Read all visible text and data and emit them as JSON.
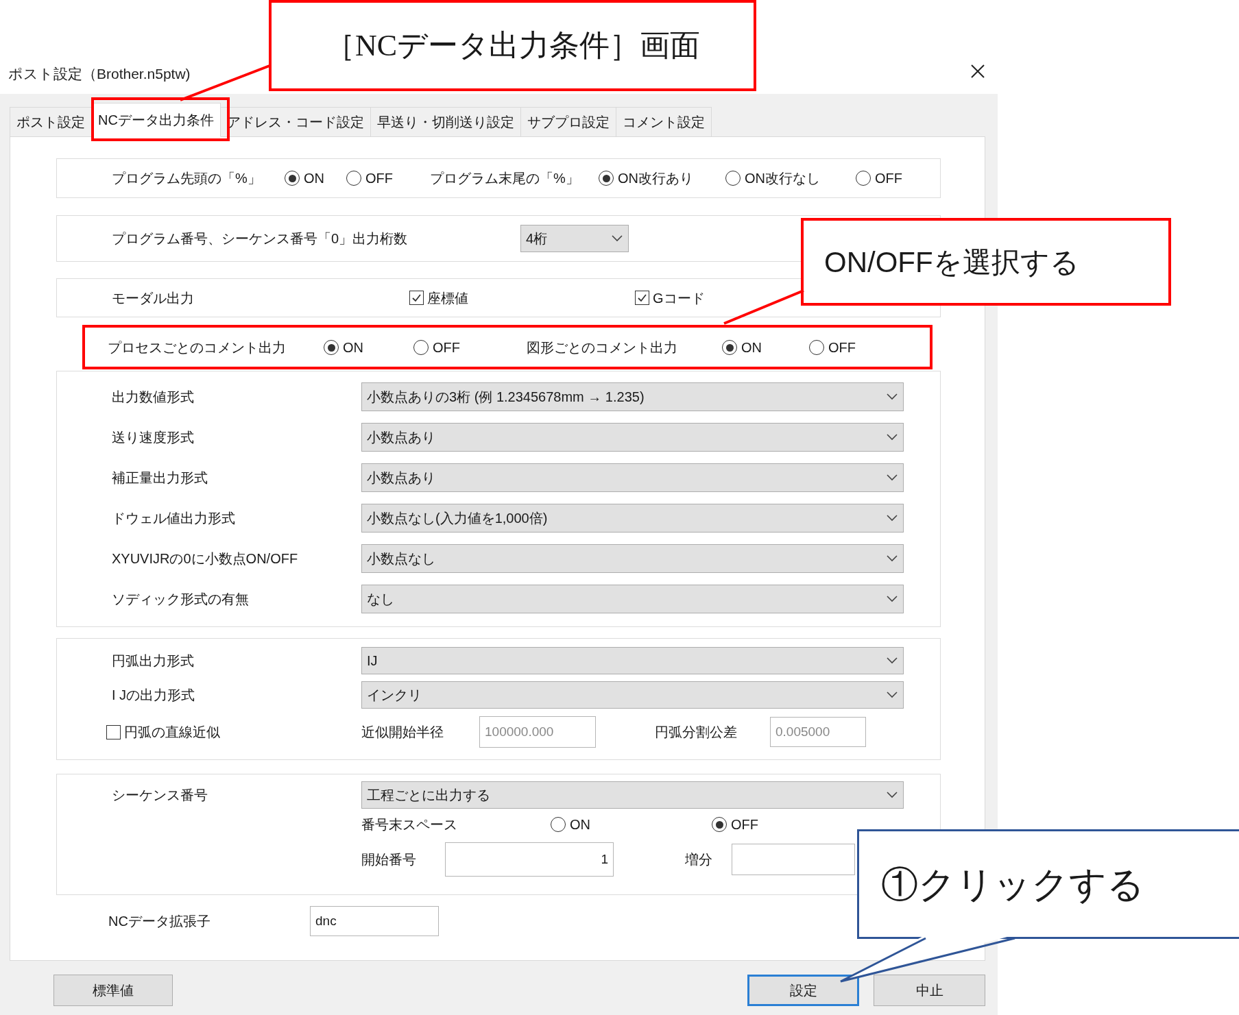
{
  "window": {
    "title": "ポスト設定（Brother.n5ptw)"
  },
  "tabs": [
    {
      "label": "ポスト設定",
      "selected": false
    },
    {
      "label": "NCデータ出力条件",
      "selected": true
    },
    {
      "label": "アドレス・コード設定",
      "selected": false
    },
    {
      "label": "早送り・切削送り設定",
      "selected": false
    },
    {
      "label": "サブプロ設定",
      "selected": false
    },
    {
      "label": "コメント設定",
      "selected": false
    }
  ],
  "program_percent": {
    "start_label": "プログラム先頭の「%」",
    "start_options": [
      {
        "label": "ON",
        "selected": true
      },
      {
        "label": "OFF",
        "selected": false
      }
    ],
    "end_label": "プログラム末尾の「%」",
    "end_options": [
      {
        "label": "ON改行あり",
        "selected": true
      },
      {
        "label": "ON改行なし",
        "selected": false
      },
      {
        "label": "OFF",
        "selected": false
      }
    ]
  },
  "digits": {
    "label": "プログラム番号、シーケンス番号「0」出力桁数",
    "value": "4桁"
  },
  "modal_output": {
    "label": "モーダル出力",
    "checks": [
      {
        "label": "座標値",
        "checked": true
      },
      {
        "label": "Gコード",
        "checked": true
      }
    ]
  },
  "comment_output": {
    "process_label": "プロセスごとのコメント出力",
    "process_options": [
      {
        "label": "ON",
        "selected": true
      },
      {
        "label": "OFF",
        "selected": false
      }
    ],
    "shape_label": "図形ごとのコメント出力",
    "shape_options": [
      {
        "label": "ON",
        "selected": true
      },
      {
        "label": "OFF",
        "selected": false
      }
    ]
  },
  "format_settings": [
    {
      "label": "出力数値形式",
      "value": "小数点ありの3桁 (例 1.2345678mm → 1.235)"
    },
    {
      "label": "送り速度形式",
      "value": "小数点あり"
    },
    {
      "label": "補正量出力形式",
      "value": "小数点あり"
    },
    {
      "label": "ドウェル値出力形式",
      "value": "小数点なし(入力値を1,000倍)"
    },
    {
      "label": "XYUVIJRの0に小数点ON/OFF",
      "value": "小数点なし"
    },
    {
      "label": "ソディック形式の有無",
      "value": "なし"
    }
  ],
  "arc_settings": {
    "rows": [
      {
        "label": "円弧出力形式",
        "value": "IJ"
      },
      {
        "label": "I Jの出力形式",
        "value": "インクリ"
      }
    ],
    "linear_approx": {
      "label": "円弧の直線近似",
      "checked": false
    },
    "start_radius": {
      "label": "近似開始半径",
      "value": "100000.000"
    },
    "tolerance": {
      "label": "円弧分割公差",
      "value": "0.005000"
    }
  },
  "sequence": {
    "label": "シーケンス番号",
    "value": "工程ごとに出力する",
    "space_label": "番号末スペース",
    "space_options": [
      {
        "label": "ON",
        "selected": false
      },
      {
        "label": "OFF",
        "selected": true
      }
    ],
    "start_label": "開始番号",
    "start_value": "1",
    "increment_label": "増分"
  },
  "extension": {
    "label": "NCデータ拡張子",
    "value": "dnc"
  },
  "buttons": [
    {
      "label": "標準値",
      "default": false
    },
    {
      "label": "設定",
      "default": true
    },
    {
      "label": "中止",
      "default": false
    }
  ],
  "annotations": [
    {
      "text": "［NCデータ出力条件］画面",
      "color": "#ff0000"
    },
    {
      "text": "ON/OFFを選択する",
      "color": "#ff0000"
    },
    {
      "text": "①クリックする",
      "color": "#2f5597"
    }
  ]
}
